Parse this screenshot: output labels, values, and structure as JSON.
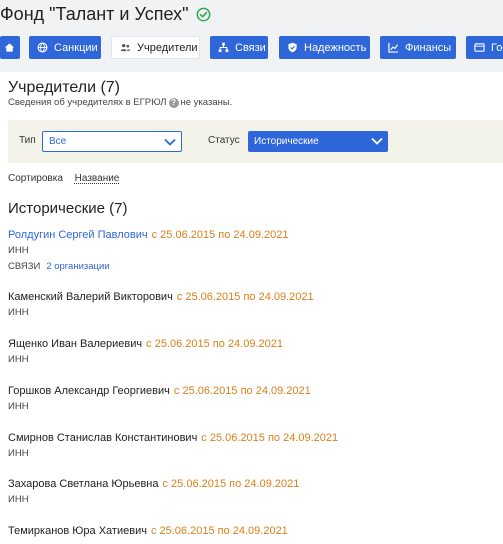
{
  "org": {
    "title": "Фонд \"Талант и Успех\"",
    "verified_icon": "check-circle-icon"
  },
  "nav": [
    {
      "label": "",
      "icon": "home-icon",
      "active": false
    },
    {
      "label": "Санкции",
      "icon": "globe-icon",
      "active": false
    },
    {
      "label": "Учредители",
      "icon": "people-icon",
      "active": true
    },
    {
      "label": "Связи",
      "icon": "network-icon",
      "active": false
    },
    {
      "label": "Надежность",
      "icon": "shield-icon",
      "active": false
    },
    {
      "label": "Финансы",
      "icon": "chart-icon",
      "active": false
    },
    {
      "label": "Гос",
      "icon": "gov-icon",
      "active": false
    }
  ],
  "section": {
    "title": "Учредители (7)",
    "subtitle_pre": "Сведения об учредителях в ЕГРЮЛ",
    "subtitle_post": "не указаны."
  },
  "filters": {
    "type_label": "Тип",
    "type_value": "Все",
    "status_label": "Статус",
    "status_value": "Исторические"
  },
  "sort": {
    "label": "Сортировка",
    "value": "Название"
  },
  "group": {
    "title": "Исторические (7)"
  },
  "persons": [
    {
      "name": "Ролдугин Сергей Павлович",
      "dates": "с 25.06.2015 по 24.09.2021",
      "inn": "ИНН",
      "links_label": "СВЯЗИ",
      "links_value": "2 организации"
    },
    {
      "name": "Каменский Валерий Викторович",
      "dates": "с 25.06.2015 по 24.09.2021",
      "inn": "ИНН"
    },
    {
      "name": "Ященко Иван Валериевич",
      "dates": "с 25.06.2015 по 24.09.2021",
      "inn": "ИНН"
    },
    {
      "name": "Горшков Александр Георгиевич",
      "dates": "с 25.06.2015 по 24.09.2021",
      "inn": "ИНН"
    },
    {
      "name": "Смирнов Станислав Константинович",
      "dates": "с 25.06.2015 по 24.09.2021",
      "inn": "ИНН"
    },
    {
      "name": "Захарова Светлана Юрьевна",
      "dates": "с 25.06.2015 по 24.09.2021",
      "inn": "ИНН"
    },
    {
      "name": "Темирканов Юра Хатиевич",
      "dates": "с 25.06.2015 по 24.09.2021",
      "inn": ""
    }
  ],
  "colors": {
    "accent": "#2f66d9",
    "date": "#d9801a",
    "verified": "#2fa84f",
    "filter_bg": "#f3f3ea"
  }
}
